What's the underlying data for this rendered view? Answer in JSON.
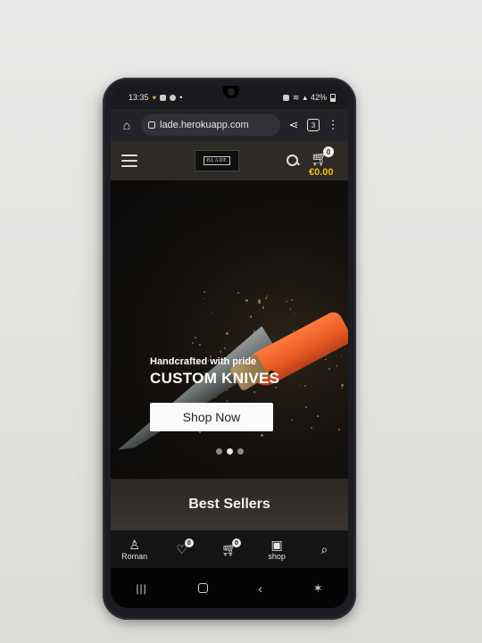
{
  "statusbar": {
    "time": "13:35",
    "battery": "42%"
  },
  "browser": {
    "url": "lade.herokuapp.com",
    "tab_count": "3"
  },
  "header": {
    "logo_text": "BLADE",
    "cart_count": "0",
    "cart_total": "€0.00"
  },
  "hero": {
    "tagline": "Handcrafted with pride",
    "title": "CUSTOM KNIVES",
    "cta_label": "Shop Now",
    "slide_count": 3,
    "active_slide": 2
  },
  "section": {
    "best_sellers_title": "Best Sellers"
  },
  "bottom_nav": {
    "items": [
      {
        "icon": "user-icon",
        "label": "Roman"
      },
      {
        "icon": "heart-check-icon",
        "label": "",
        "badge": "0"
      },
      {
        "icon": "cart-icon",
        "label": "",
        "badge": "0"
      },
      {
        "icon": "shop-icon",
        "label": "shop"
      },
      {
        "icon": "search-icon",
        "label": ""
      }
    ]
  },
  "colors": {
    "accent": "#f2c012",
    "handle": "#e85a22",
    "background": "#e6e5e2"
  }
}
